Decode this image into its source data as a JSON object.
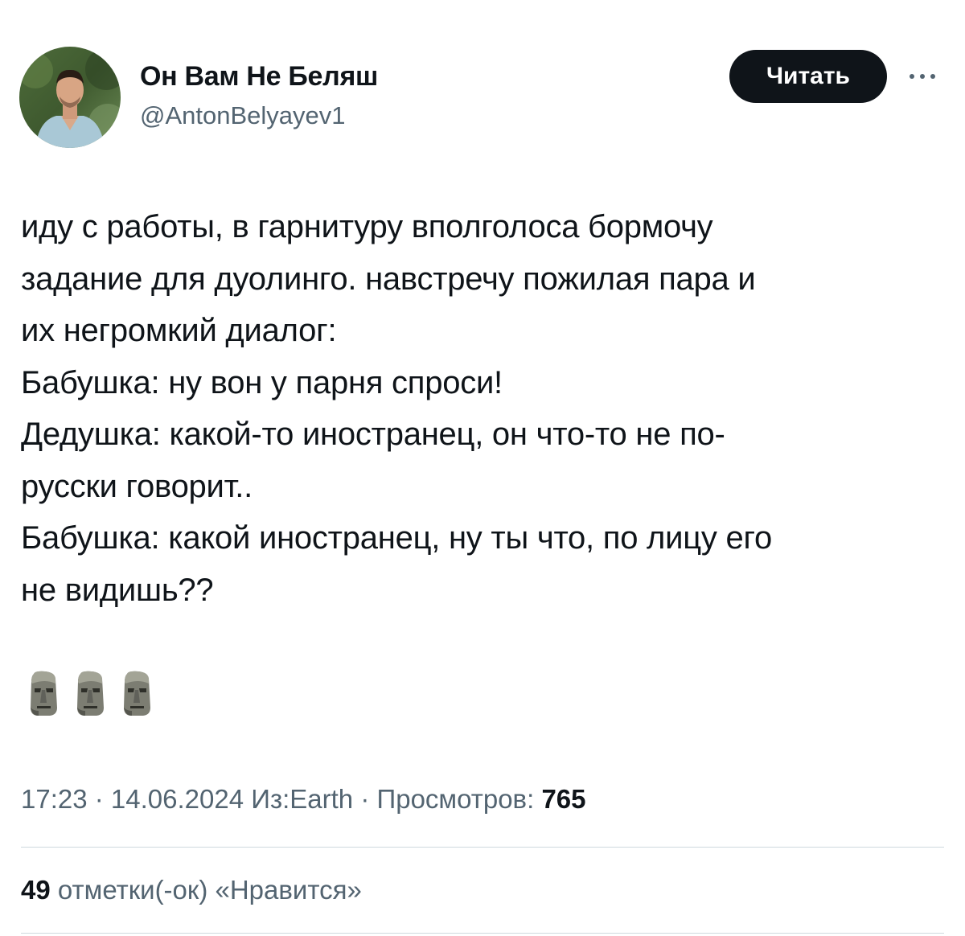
{
  "author": {
    "display_name": "Он Вам Не Беляш",
    "handle": "@AntonBelyayev1",
    "avatar_icon": "user-avatar-photo"
  },
  "follow_button": {
    "label": "Читать",
    "bg": "#0f1419",
    "color": "#ffffff"
  },
  "more_icon": "ellipsis-icon",
  "tweet": {
    "lines": [
      "иду с работы, в гарнитуру вполголоса бормочу",
      "задание для дуолинго. навстречу пожилая пара и",
      "их негромкий диалог:",
      "Бабушка: ну вон у парня спроси!",
      "Дедушка: какой-то иностранец, он что-то не по-",
      "русски говорит..",
      "Бабушка: какой иностранец, ну ты что, по лицу его",
      "не видишь??"
    ],
    "emoji": [
      "moai-emoji",
      "moai-emoji",
      "moai-emoji"
    ]
  },
  "meta": {
    "time": "17:23",
    "separator": " · ",
    "date": "14.06.2024",
    "source": "Из:Earth",
    "views_label": "Просмотров:",
    "views_count": "765"
  },
  "likes": {
    "count": "49",
    "label": "отметки(-ок) «Нравится»"
  },
  "colors": {
    "text": "#0f1419",
    "secondary": "#536471",
    "divider": "#cfd9de"
  }
}
